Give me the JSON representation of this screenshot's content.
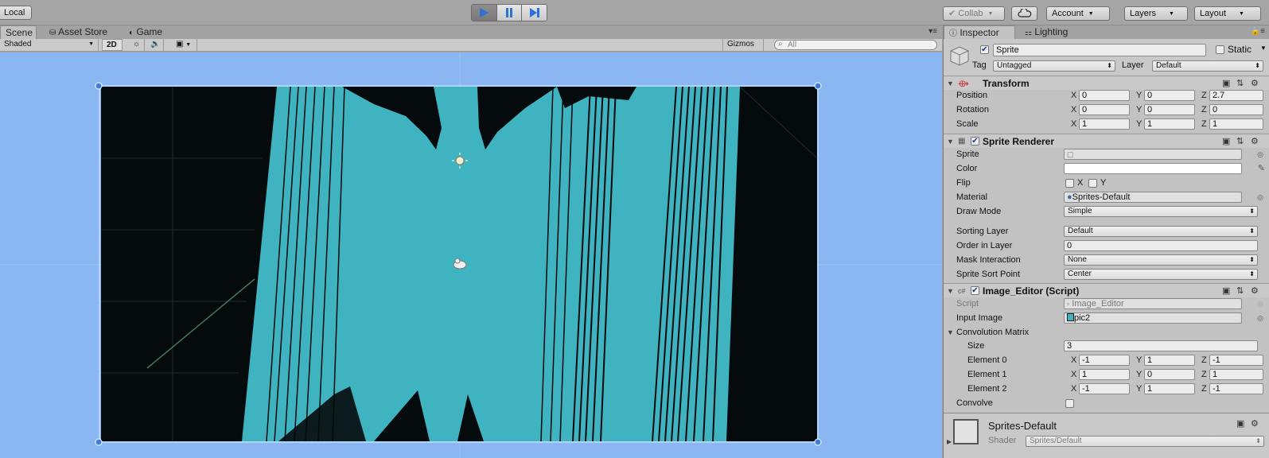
{
  "toolbar": {
    "local_label": "Local",
    "collab_label": "Collab",
    "account_label": "Account",
    "layers_label": "Layers",
    "layout_label": "Layout"
  },
  "scene": {
    "tabs": [
      {
        "label": "Scene",
        "icon": "scene-icon"
      },
      {
        "label": "Asset Store",
        "icon": "store-icon"
      },
      {
        "label": "Game",
        "icon": "game-icon"
      }
    ],
    "shading_mode": "Shaded",
    "mode_2d": "2D",
    "gizmos_label": "Gizmos",
    "search_placeholder": "All",
    "colors": {
      "background": "#8ab6f1",
      "sprite_black": "#050a0c",
      "sprite_teal": "#3fb3bf"
    }
  },
  "inspector": {
    "tabs": [
      {
        "label": "Inspector",
        "icon": "info-icon"
      },
      {
        "label": "Lighting",
        "icon": "lighting-icon"
      }
    ],
    "object": {
      "name": "Sprite",
      "static_label": "Static",
      "tag_label": "Tag",
      "tag_value": "Untagged",
      "layer_label": "Layer",
      "layer_value": "Default"
    },
    "transform": {
      "title": "Transform",
      "position_label": "Position",
      "rotation_label": "Rotation",
      "scale_label": "Scale",
      "position": {
        "x": "0",
        "y": "0",
        "z": "2.7"
      },
      "rotation": {
        "x": "0",
        "y": "0",
        "z": "0"
      },
      "scale": {
        "x": "1",
        "y": "1",
        "z": "1"
      }
    },
    "sprite_renderer": {
      "title": "Sprite Renderer",
      "sprite_label": "Sprite",
      "color_label": "Color",
      "flip_label": "Flip",
      "flip_x": "X",
      "flip_y": "Y",
      "material_label": "Material",
      "material_value": "Sprites-Default",
      "draw_mode_label": "Draw Mode",
      "draw_mode_value": "Simple",
      "sorting_layer_label": "Sorting Layer",
      "sorting_layer_value": "Default",
      "order_label": "Order in Layer",
      "order_value": "0",
      "mask_label": "Mask Interaction",
      "mask_value": "None",
      "sort_point_label": "Sprite Sort Point",
      "sort_point_value": "Center"
    },
    "image_editor": {
      "title": "Image_Editor (Script)",
      "script_label": "Script",
      "script_value": "Image_Editor",
      "input_label": "Input Image",
      "input_value": "pic2",
      "conv_label": "Convolution Matrix",
      "size_label": "Size",
      "size_value": "3",
      "elements": [
        {
          "label": "Element 0",
          "x": "-1",
          "y": "1",
          "z": "-1"
        },
        {
          "label": "Element 1",
          "x": "1",
          "y": "0",
          "z": "1"
        },
        {
          "label": "Element 2",
          "x": "-1",
          "y": "1",
          "z": "-1"
        }
      ],
      "convolve_label": "Convolve"
    },
    "material_footer": {
      "name": "Sprites-Default",
      "shader_label": "Shader",
      "shader_value": "Sprites/Default"
    },
    "axis": {
      "x": "X",
      "y": "Y",
      "z": "Z"
    }
  }
}
